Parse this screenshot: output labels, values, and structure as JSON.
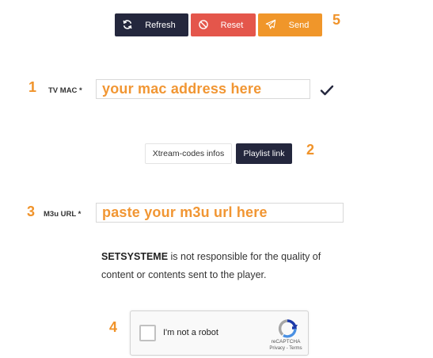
{
  "toolbar": {
    "refresh_label": "Refresh",
    "reset_label": "Reset",
    "send_label": "Send"
  },
  "steps": {
    "one": "1",
    "two": "2",
    "three": "3",
    "four": "4",
    "five": "5"
  },
  "tv_mac": {
    "label": "TV MAC *",
    "placeholder": "your mac address here"
  },
  "tabs": [
    {
      "label": "Xtream-codes infos",
      "active": false
    },
    {
      "label": "Playlist link",
      "active": true
    }
  ],
  "m3u_url": {
    "label": "M3u URL *",
    "placeholder": "paste your m3u url here"
  },
  "notice": {
    "brand": "SETSYSTEME",
    "text": " is not responsible for the quality of content or contents sent to the player."
  },
  "captcha": {
    "label": "I'm not a robot",
    "brand": "reCAPTCHA",
    "links": "Privacy - Terms"
  },
  "colors": {
    "dark": "#24273d",
    "reset": "#e4564b",
    "send": "#f0962a",
    "accent": "#f0932a"
  },
  "icons": {
    "refresh": "refresh-icon",
    "reset": "ban-icon",
    "send": "paper-plane-icon",
    "valid": "checkmark-icon",
    "captcha": "recaptcha-logo-icon"
  }
}
